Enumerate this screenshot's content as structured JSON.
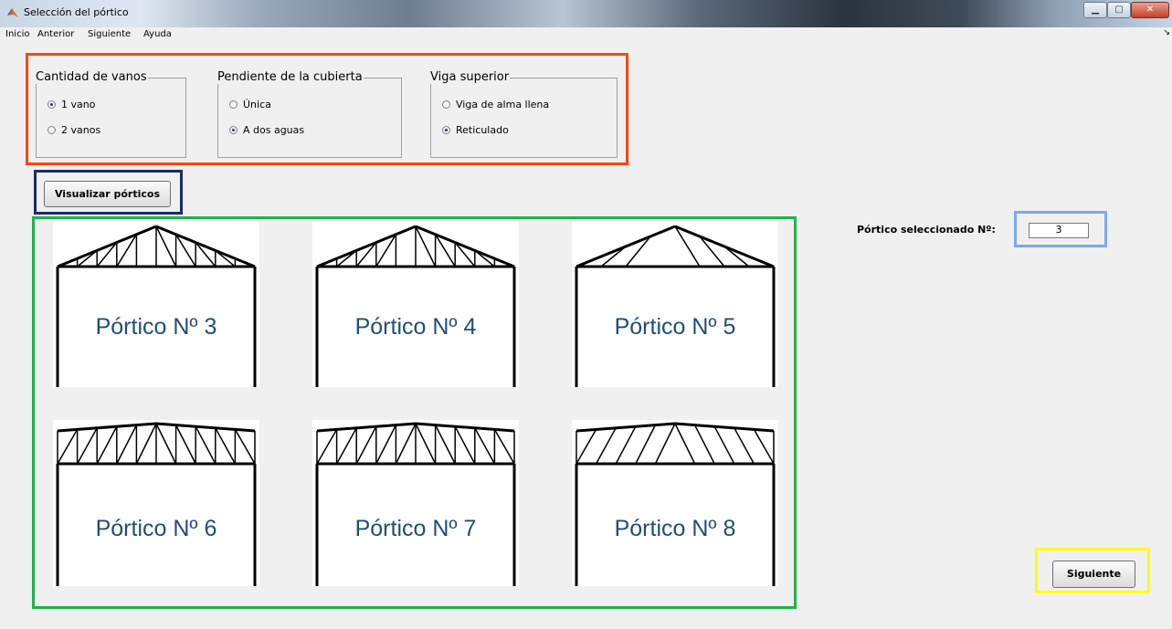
{
  "window": {
    "title": "Selección del pórtico"
  },
  "menu": [
    "Inicio",
    "Anterior",
    "Siguiente",
    "Ayuda"
  ],
  "groups": {
    "vanos": {
      "title": "Cantidad de vanos",
      "options": [
        "1 vano",
        "2 vanos"
      ],
      "selected": 0
    },
    "pendiente": {
      "title": "Pendiente de la cubierta",
      "options": [
        "Única",
        "A dos aguas"
      ],
      "selected": 1
    },
    "viga": {
      "title": "Viga superior",
      "options": [
        "Viga de alma llena",
        "Reticulado"
      ],
      "selected": 1
    }
  },
  "buttons": {
    "visualizar": "Visualizar pórticos",
    "siguiente": "Siguiente"
  },
  "porticos": [
    {
      "label": "Pórtico Nº 3",
      "roof": "gable"
    },
    {
      "label": "Pórtico Nº 4",
      "roof": "gable"
    },
    {
      "label": "Pórtico Nº 5",
      "roof": "gable"
    },
    {
      "label": "Pórtico Nº 6",
      "roof": "flat"
    },
    {
      "label": "Pórtico Nº 7",
      "roof": "flat"
    },
    {
      "label": "Pórtico Nº 8",
      "roof": "flat"
    }
  ],
  "selection": {
    "label": "Pórtico seleccionado Nº:",
    "value": "3"
  },
  "colors": {
    "options_frame": "#ff4500",
    "button_frame": "#1a2a6c",
    "gallery_frame": "#22b14c",
    "input_frame": "#7fa7f2",
    "next_frame": "#ffff00"
  }
}
